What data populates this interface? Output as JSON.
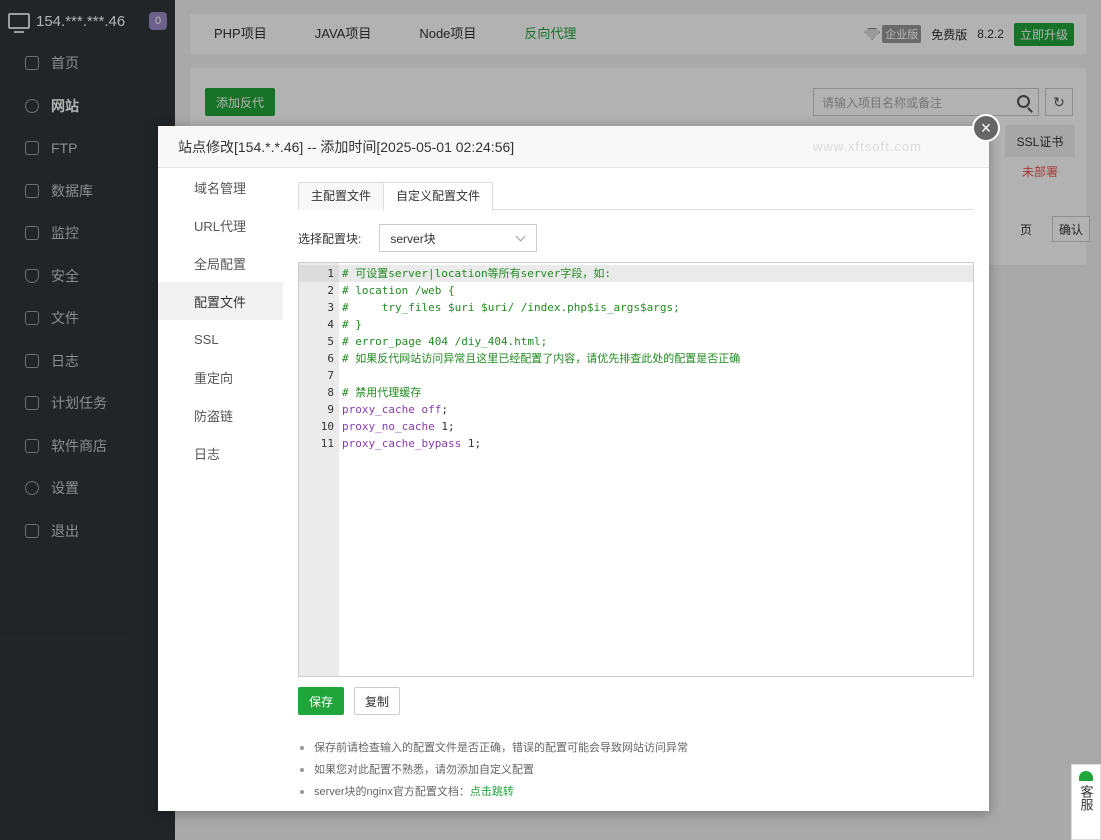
{
  "sidebar": {
    "server": "154.***.***.46",
    "badge": "0",
    "items": [
      {
        "label": "首页",
        "icon": "home-icon"
      },
      {
        "label": "网站",
        "icon": "globe-icon"
      },
      {
        "label": "FTP",
        "icon": "ftp-icon"
      },
      {
        "label": "数据库",
        "icon": "database-icon"
      },
      {
        "label": "监控",
        "icon": "monitor-icon"
      },
      {
        "label": "安全",
        "icon": "shield-icon"
      },
      {
        "label": "文件",
        "icon": "folder-icon"
      },
      {
        "label": "日志",
        "icon": "log-icon"
      },
      {
        "label": "计划任务",
        "icon": "calendar-icon"
      },
      {
        "label": "软件商店",
        "icon": "apps-icon"
      },
      {
        "label": "设置",
        "icon": "gear-icon"
      },
      {
        "label": "退出",
        "icon": "logout-icon"
      }
    ]
  },
  "topbar": {
    "tabs": [
      "PHP项目",
      "JAVA项目",
      "Node项目",
      "反向代理"
    ],
    "edition_label": "企业版",
    "plan": "免费版",
    "version": "8.2.2",
    "upgrade": "立即升级"
  },
  "panel": {
    "add_button": "添加反代",
    "search_placeholder": "请输入项目名称或备注",
    "ssl_header": "SSL证书",
    "ssl_value": "未部署",
    "page_label": "页",
    "confirm": "确认"
  },
  "modal": {
    "title": "站点修改[154.*.*.46] -- 添加时间[2025-05-01 02:24:56]",
    "watermark": "www.xftsoft.com",
    "nav": [
      "域名管理",
      "URL代理",
      "全局配置",
      "配置文件",
      "SSL",
      "重定向",
      "防盗链",
      "日志"
    ],
    "subtabs": [
      "主配置文件",
      "自定义配置文件"
    ],
    "select_label": "选择配置块:",
    "select_value": "server块",
    "save": "保存",
    "copy": "复制",
    "tips": [
      "保存前请检查输入的配置文件是否正确，错误的配置可能会导致网站访问异常",
      "如果您对此配置不熟悉，请勿添加自定义配置",
      "server块的nginx官方配置文档："
    ],
    "tip_link": "点击跳转"
  },
  "editor": {
    "line_numbers": [
      "1",
      "2",
      "3",
      "4",
      "5",
      "6",
      "7",
      "8",
      "9",
      "10",
      "11"
    ]
  },
  "kefu": "客服"
}
